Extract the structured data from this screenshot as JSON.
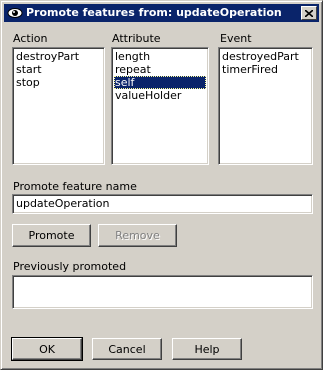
{
  "window": {
    "title": "Promote features from: updateOperation"
  },
  "action": {
    "label": "Action",
    "items": [
      "destroyPart",
      "start",
      "stop"
    ]
  },
  "attribute": {
    "label": "Attribute",
    "items": [
      "length",
      "repeat",
      "self",
      "valueHolder"
    ],
    "selected_index": 2
  },
  "event": {
    "label": "Event",
    "items": [
      "destroyedPart",
      "timerFired"
    ]
  },
  "promote_name": {
    "label": "Promote feature name",
    "value": "updateOperation"
  },
  "buttons": {
    "promote": "Promote",
    "remove": "Remove",
    "ok": "OK",
    "cancel": "Cancel",
    "help": "Help"
  },
  "previously": {
    "label": "Previously promoted"
  },
  "icons": {
    "title": "eye-icon",
    "close": "close-icon"
  }
}
